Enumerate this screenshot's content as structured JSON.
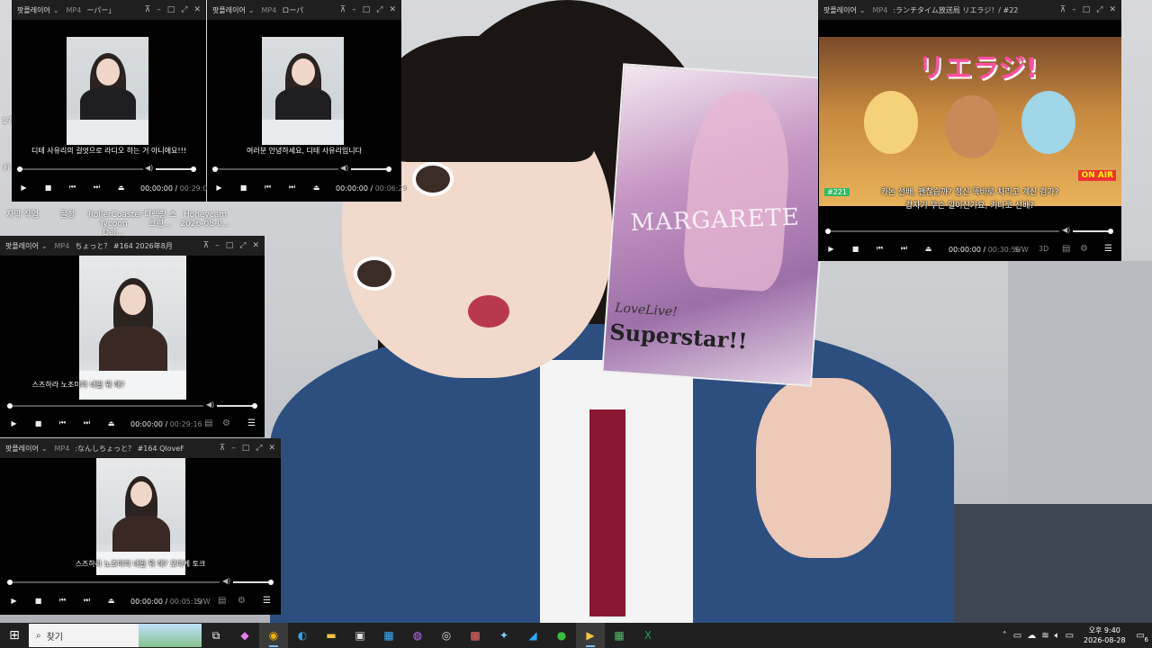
{
  "desktop": {
    "icons": [
      {
        "label": "자막 작업"
      },
      {
        "label": "골정"
      },
      {
        "label": "RollerCoaster Tycoon Del..."
      },
      {
        "label": "디렉링 스크린..."
      },
      {
        "label": "Honeycam 2026-08-0..."
      }
    ],
    "side_label": "17",
    "side_label2": "Fi",
    "card": {
      "title": "MARGARETE",
      "logo_line1": "LoveLive!",
      "logo_line2": "Superstar!!"
    }
  },
  "players": [
    {
      "app": "팟플레이어",
      "format": "MP4",
      "title": "ーパー」",
      "subtitle": "디테 사유리의 걸엇으로 라디오 하는 거 아니에요!!!",
      "time": "00:00:00",
      "duration": "00:29:01",
      "extra": ""
    },
    {
      "app": "팟플레이어",
      "format": "MP4",
      "title": "ローパ",
      "subtitle": "여러분 안녕하세요, 디테 사유리입니다",
      "time": "00:00:00",
      "duration": "00:06:29",
      "extra": ""
    },
    {
      "app": "팟플레이어",
      "format": "MP4",
      "title": ":ランチタイム放送局 リエラジ！/ #22",
      "subtitle_line1": "카논 선배, 괜찮습까? 정신 똑바로 차리고 계신 검가?",
      "subtitle_line2": "갑자기 무슨 일이신가요, 키나코 선배?",
      "time": "00:00:00",
      "duration": "00:30:56",
      "extra": "S/W",
      "extra2": "3D",
      "video_badge": "#221",
      "video_logo": "リエラジ!",
      "onair": "ON AIR"
    },
    {
      "app": "팟플레이어",
      "format": "MP4",
      "title": "ちょっと？ #164 2026年8月",
      "subtitle": "스즈하라 노조미의 내일 뭐 해?",
      "time": "00:00:00",
      "duration": "00:29:16",
      "extra": ""
    },
    {
      "app": "팟플레이어",
      "format": "MP4",
      "title": ":なんしちょっと？ #164 QloveF",
      "subtitle": "스즈하라 노조미의 내일 뭐 해? 오마케 토크",
      "time": "00:00:00",
      "duration": "00:05:19",
      "extra": "S/W"
    }
  ],
  "taskbar": {
    "search_placeholder": "찾기",
    "time": "오후 9:40",
    "date": "2026-08-28",
    "notification_count": "6"
  }
}
